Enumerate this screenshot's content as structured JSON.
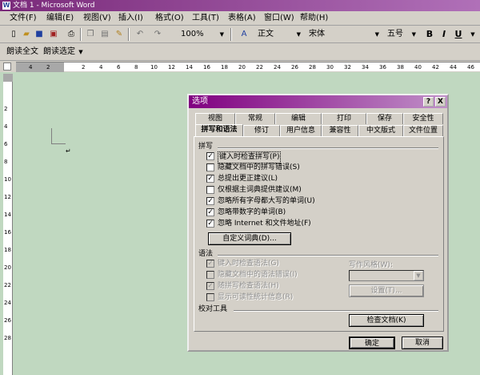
{
  "window": {
    "title": "文档 1 - Microsoft Word",
    "icon": "word-icon"
  },
  "menu": [
    "文件(F)",
    "编辑(E)",
    "视图(V)",
    "插入(I)",
    "格式(O)",
    "工具(T)",
    "表格(A)",
    "窗口(W)",
    "帮助(H)"
  ],
  "toolbar": {
    "zoom": "100%",
    "style": "正文",
    "font": "宋体",
    "size": "五号",
    "bold": "B",
    "italic": "I",
    "underline": "U"
  },
  "reading_bar": {
    "read_all": "朗读全文",
    "read_selected": "朗读选定"
  },
  "ruler": {
    "h_numbers": [
      "4",
      "2",
      "",
      "2",
      "4",
      "6",
      "8",
      "10",
      "12",
      "14",
      "16",
      "18",
      "20",
      "22",
      "24",
      "26",
      "28",
      "30",
      "32",
      "34",
      "36",
      "38",
      "40",
      "42",
      "44",
      "46"
    ],
    "v_numbers": [
      "2",
      "4",
      "6",
      "8",
      "10",
      "12",
      "14",
      "16",
      "18",
      "20",
      "22",
      "24",
      "26",
      "28"
    ]
  },
  "dialog": {
    "title": "选项",
    "help_btn": "?",
    "close_btn": "X",
    "tabs_row1": [
      "视图",
      "常规",
      "编辑",
      "打印",
      "保存",
      "安全性"
    ],
    "tabs_row2": [
      "拼写和语法",
      "修订",
      "用户信息",
      "兼容性",
      "中文版式",
      "文件位置"
    ],
    "spelling": {
      "label": "拼写",
      "options": [
        {
          "label": "键入时检查拼写(P)",
          "checked": true
        },
        {
          "label": "隐藏文档中的拼写错误(S)",
          "checked": false
        },
        {
          "label": "总提出更正建议(L)",
          "checked": true
        },
        {
          "label": "仅根据主词典提供建议(M)",
          "checked": false
        },
        {
          "label": "忽略所有字母都大写的单词(U)",
          "checked": true
        },
        {
          "label": "忽略带数字的单词(B)",
          "checked": true
        },
        {
          "label": "忽略 Internet 和文件地址(F)",
          "checked": true
        }
      ],
      "custom_dict_btn": "自定义词典(D)..."
    },
    "grammar": {
      "label": "语法",
      "options": [
        {
          "label": "键入时检查语法(G)",
          "checked": true
        },
        {
          "label": "隐藏文档中的语法错误(I)",
          "checked": false
        },
        {
          "label": "随拼写检查语法(H)",
          "checked": true
        },
        {
          "label": "显示可读性统计信息(R)",
          "checked": false
        }
      ],
      "writing_style_label": "写作风格(W):",
      "settings_btn": "设置(T)..."
    },
    "proofing": {
      "label": "校对工具",
      "recheck_btn": "检查文档(K)"
    },
    "ok": "确定",
    "cancel": "取消"
  }
}
